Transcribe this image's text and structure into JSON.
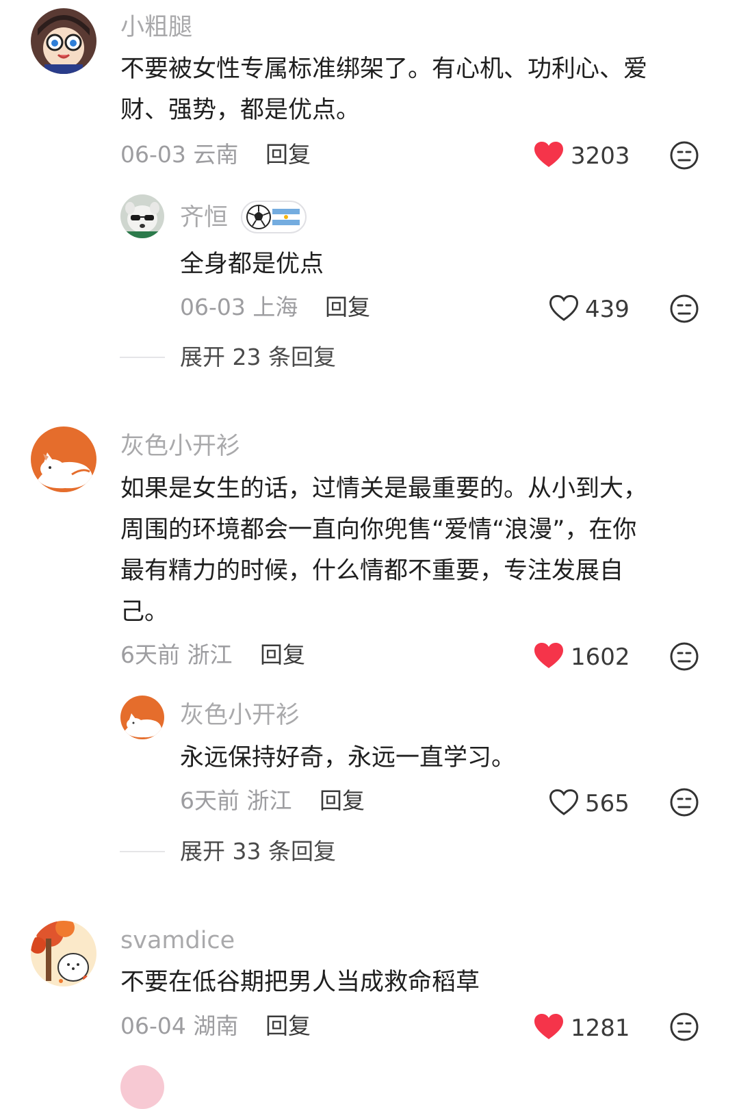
{
  "comments": [
    {
      "username": "小粗腿",
      "text_lines": [
        "不要被女性专属标准绑架了。有心机、功利心、爱",
        "财、强势，都是优点。"
      ],
      "meta": "06-03 云南",
      "reply_label": "回复",
      "likes": "3203",
      "liked": true,
      "reply": {
        "username": "齐恒",
        "text": "全身都是优点",
        "meta": "06-03 上海",
        "reply_label": "回复",
        "likes": "439",
        "liked": false
      },
      "expand_label": "展开 23 条回复"
    },
    {
      "username": "灰色小开衫",
      "text_lines": [
        "如果是女生的话，过情关是最重要的。从小到大，",
        "周围的环境都会一直向你兜售“爱情“浪漫”，在你",
        "最有精力的时候，什么情都不重要，专注发展自",
        "己。"
      ],
      "meta": "6天前 浙江",
      "reply_label": "回复",
      "likes": "1602",
      "liked": true,
      "reply": {
        "username": "灰色小开衫",
        "text": "永远保持好奇，永远一直学习。",
        "meta": "6天前 浙江",
        "reply_label": "回复",
        "likes": "565",
        "liked": false
      },
      "expand_label": "展开 33 条回复"
    },
    {
      "username": "svamdice",
      "text_lines": [
        "不要在低谷期把男人当成救命稻草"
      ],
      "meta": "06-04 湖南",
      "reply_label": "回复",
      "likes": "1281",
      "liked": true
    }
  ],
  "colors": {
    "liked_heart": "#f5344a",
    "muted_text": "#a9a9ab",
    "body_text": "#1f1f1f"
  },
  "icons": {
    "like": "heart-icon",
    "dislike": "meh-face-icon"
  }
}
